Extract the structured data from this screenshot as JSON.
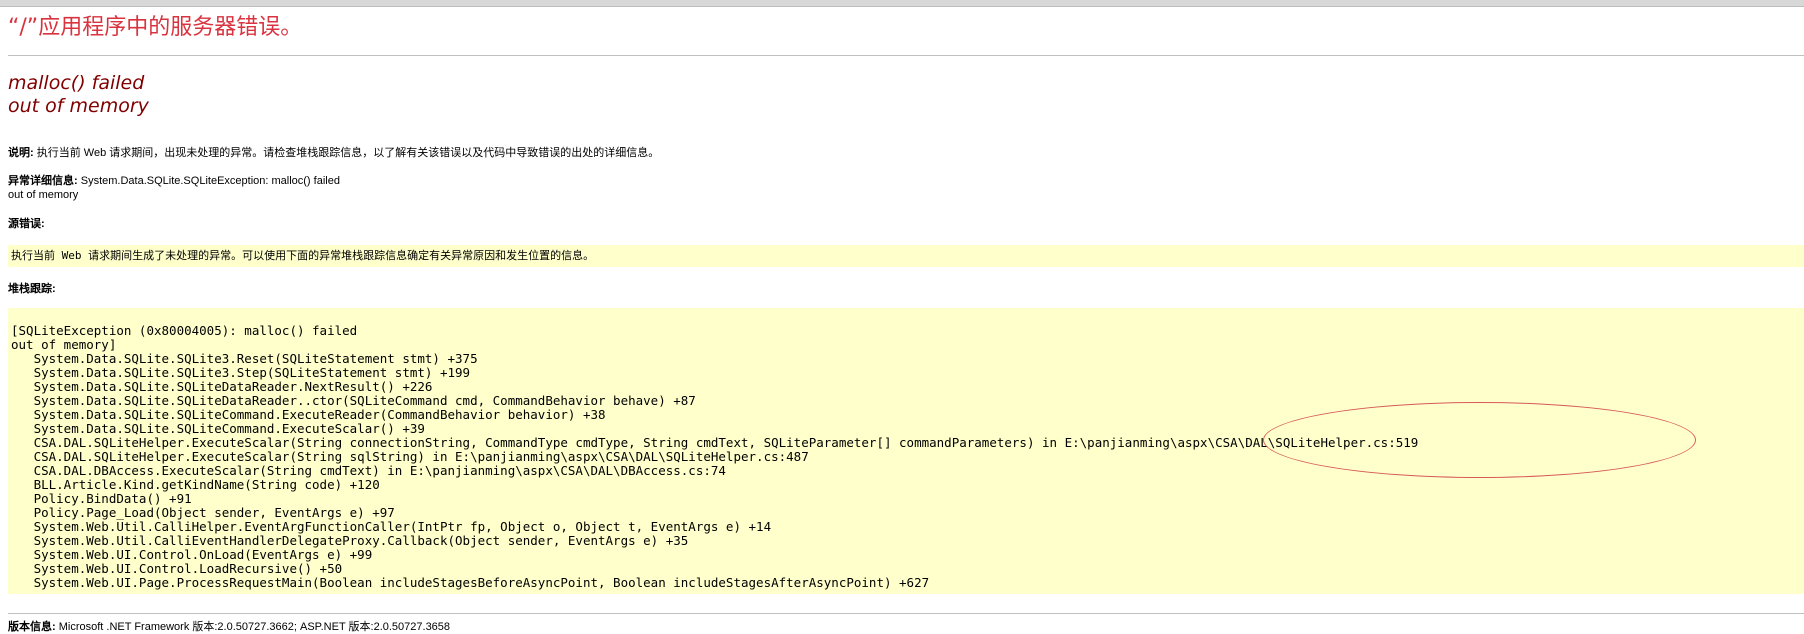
{
  "title": "“/”应用程序中的服务器错误。",
  "error_message": {
    "line1": "malloc() failed",
    "line2": "out of memory"
  },
  "description": {
    "label": "说明:",
    "text": " 执行当前 Web 请求期间，出现未处理的异常。请检查堆栈跟踪信息，以了解有关该错误以及代码中导致错误的出处的详细信息。"
  },
  "exception_details": {
    "label": "异常详细信息:",
    "text": " System.Data.SQLite.SQLiteException: malloc() failed",
    "text2": "out of memory"
  },
  "source_error": {
    "label": "源错误:",
    "text": "执行当前 Web 请求期间生成了未处理的异常。可以使用下面的异常堆栈跟踪信息确定有关异常原因和发生位置的信息。"
  },
  "stack_trace": {
    "label": "堆栈跟踪:",
    "lines": [
      "[SQLiteException (0x80004005): malloc() failed",
      "out of memory]",
      "   System.Data.SQLite.SQLite3.Reset(SQLiteStatement stmt) +375",
      "   System.Data.SQLite.SQLite3.Step(SQLiteStatement stmt) +199",
      "   System.Data.SQLite.SQLiteDataReader.NextResult() +226",
      "   System.Data.SQLite.SQLiteDataReader..ctor(SQLiteCommand cmd, CommandBehavior behave) +87",
      "   System.Data.SQLite.SQLiteCommand.ExecuteReader(CommandBehavior behavior) +38",
      "   System.Data.SQLite.SQLiteCommand.ExecuteScalar() +39",
      "   CSA.DAL.SQLiteHelper.ExecuteScalar(String connectionString, CommandType cmdType, String cmdText, SQLiteParameter[] commandParameters) in E:\\panjianming\\aspx\\CSA\\DAL\\SQLiteHelper.cs:519",
      "   CSA.DAL.SQLiteHelper.ExecuteScalar(String sqlString) in E:\\panjianming\\aspx\\CSA\\DAL\\SQLiteHelper.cs:487",
      "   CSA.DAL.DBAccess.ExecuteScalar(String cmdText) in E:\\panjianming\\aspx\\CSA\\DAL\\DBAccess.cs:74",
      "   BLL.Article.Kind.getKindName(String code) +120",
      "   Policy.BindData() +91",
      "   Policy.Page_Load(Object sender, EventArgs e) +97",
      "   System.Web.Util.CalliHelper.EventArgFunctionCaller(IntPtr fp, Object o, Object t, EventArgs e) +14",
      "   System.Web.Util.CalliEventHandlerDelegateProxy.Callback(Object sender, EventArgs e) +35",
      "   System.Web.UI.Control.OnLoad(EventArgs e) +99",
      "   System.Web.UI.Control.LoadRecursive() +50",
      "   System.Web.UI.Page.ProcessRequestMain(Boolean includeStagesBeforeAsyncPoint, Boolean includeStagesAfterAsyncPoint) +627"
    ]
  },
  "version_info": {
    "label": "版本信息:",
    "text": " Microsoft .NET Framework 版本:2.0.50727.3662; ASP.NET 版本:2.0.50727.3658"
  },
  "colors": {
    "title": "#d9333f",
    "error_message": "#800000",
    "code_background": "#ffffcc",
    "highlight_ellipse": "#d75a5a"
  }
}
